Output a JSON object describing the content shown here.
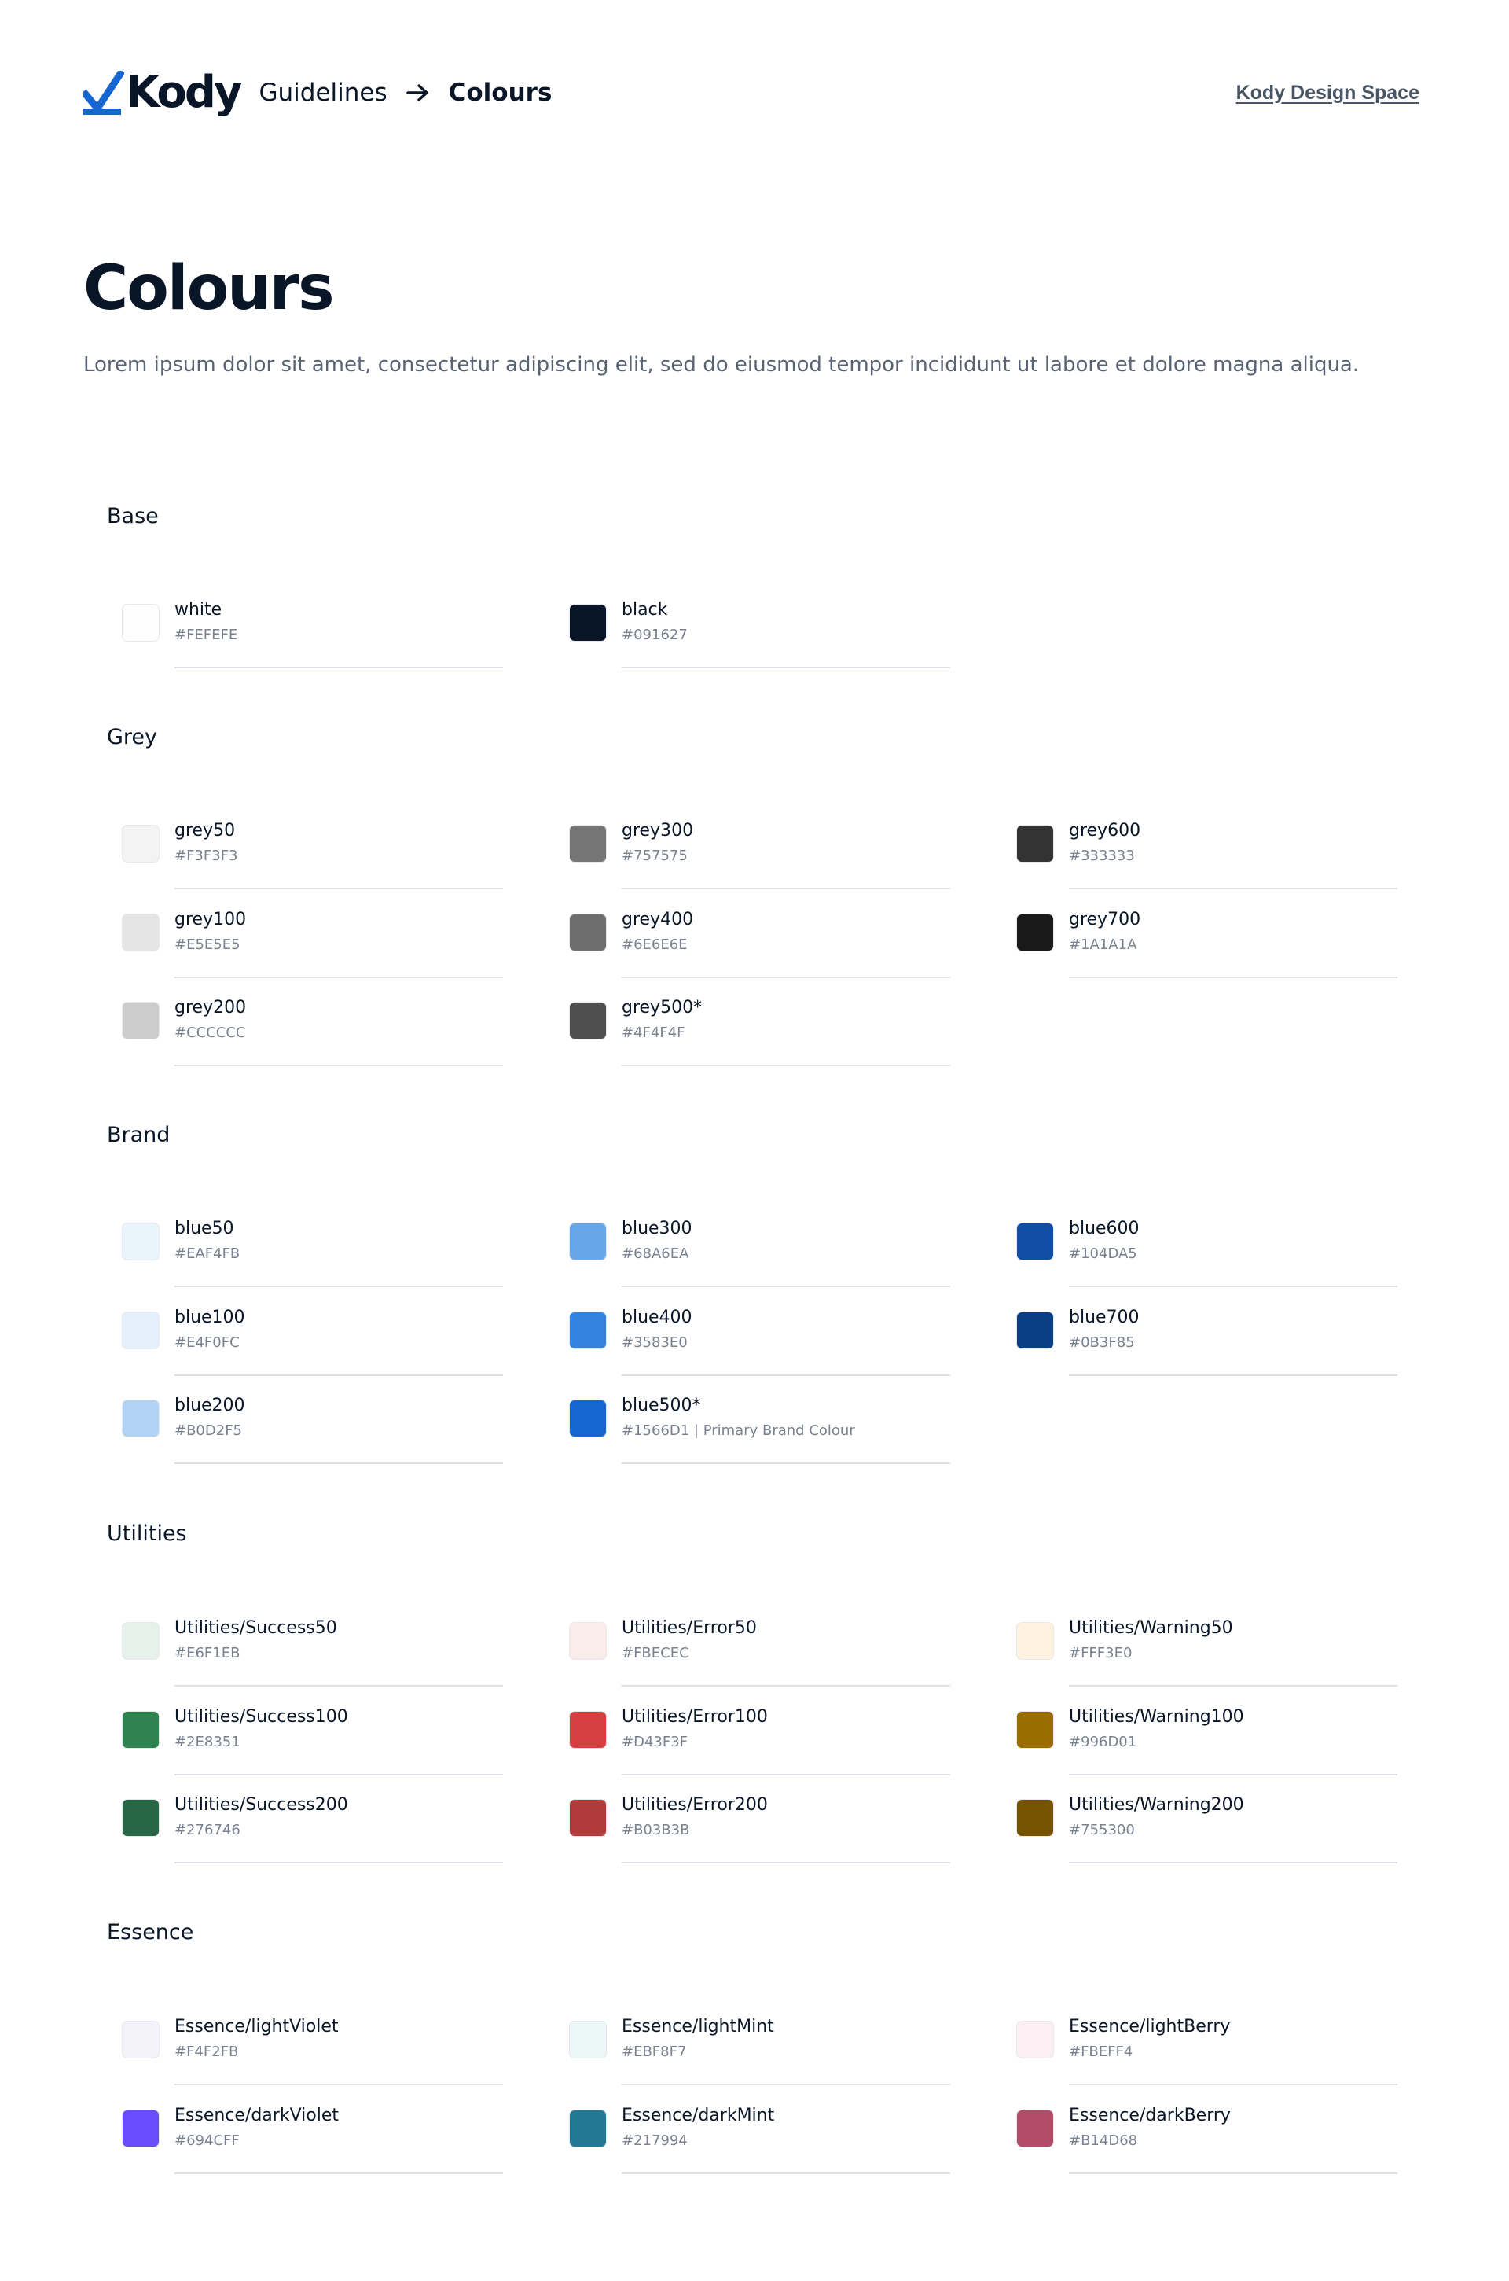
{
  "header": {
    "logo_text": "Kody",
    "breadcrumb_root": "Guidelines",
    "breadcrumb_current": "Colours",
    "space_link": "Kody Design Space"
  },
  "page": {
    "title": "Colours",
    "description": "Lorem ipsum dolor sit amet, consectetur adipiscing elit, sed do eiusmod tempor incididunt ut labore et dolore magna aliqua."
  },
  "colors": {
    "brand": "#1566D1",
    "text": "#091627"
  },
  "sections": [
    {
      "title": "Base",
      "swatches": [
        {
          "name": "white",
          "hex": "#FEFEFE"
        },
        {
          "name": "black",
          "hex": "#091627"
        }
      ]
    },
    {
      "title": "Grey",
      "swatches": [
        {
          "name": "grey50",
          "hex": "#F3F3F3"
        },
        {
          "name": "grey100",
          "hex": "#E5E5E5"
        },
        {
          "name": "grey200",
          "hex": "#CCCCCC"
        },
        {
          "name": "grey300",
          "hex": "#757575"
        },
        {
          "name": "grey400",
          "hex": "#6E6E6E"
        },
        {
          "name": "grey500*",
          "hex": "#4F4F4F"
        },
        {
          "name": "grey600",
          "hex": "#333333"
        },
        {
          "name": "grey700",
          "hex": "#1A1A1A"
        }
      ]
    },
    {
      "title": "Brand",
      "swatches": [
        {
          "name": "blue50",
          "hex": "#EAF4FB"
        },
        {
          "name": "blue100",
          "hex": "#E4F0FC"
        },
        {
          "name": "blue200",
          "hex": "#B0D2F5"
        },
        {
          "name": "blue300",
          "hex": "#68A6EA"
        },
        {
          "name": "blue400",
          "hex": "#3583E0"
        },
        {
          "name": "blue500*",
          "hex": "#1566D1",
          "note": " | Primary Brand Colour"
        },
        {
          "name": "blue600",
          "hex": "#104DA5"
        },
        {
          "name": "blue700",
          "hex": "#0B3F85"
        }
      ]
    },
    {
      "title": "Utilities",
      "swatches": [
        {
          "name": "Utilities/Success50",
          "hex": "#E6F1EB"
        },
        {
          "name": "Utilities/Success100",
          "hex": "#2E8351"
        },
        {
          "name": "Utilities/Success200",
          "hex": "#276746"
        },
        {
          "name": "Utilities/Error50",
          "hex": "#FBECEC"
        },
        {
          "name": "Utilities/Error100",
          "hex": "#D43F3F"
        },
        {
          "name": "Utilities/Error200",
          "hex": "#B03B3B"
        },
        {
          "name": "Utilities/Warning50",
          "hex": "#FFF3E0"
        },
        {
          "name": "Utilities/Warning100",
          "hex": "#996D01"
        },
        {
          "name": "Utilities/Warning200",
          "hex": "#755300"
        }
      ]
    },
    {
      "title": "Essence",
      "swatches": [
        {
          "name": "Essence/lightViolet",
          "hex": "#F4F2FB"
        },
        {
          "name": "Essence/darkViolet",
          "hex": "#694CFF"
        },
        {
          "name": "Essence/lightMint",
          "hex": "#EBF8F7"
        },
        {
          "name": "Essence/darkMint",
          "hex": "#217994"
        },
        {
          "name": "Essence/lightBerry",
          "hex": "#FBEFF4"
        },
        {
          "name": "Essence/darkBerry",
          "hex": "#B14D68"
        }
      ]
    }
  ]
}
